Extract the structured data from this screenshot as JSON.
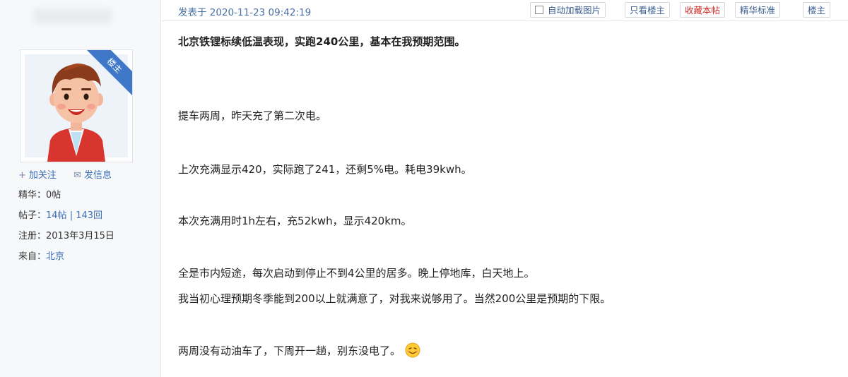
{
  "sidebar": {
    "badge": "楼主",
    "follow_label": "加关注",
    "message_label": "发信息",
    "info": {
      "essence_label": "精华：",
      "essence_value": "0帖",
      "posts_label": "帖子：",
      "posts_topics": "14帖",
      "posts_sep": "|",
      "posts_replies": "143回",
      "registered_label": "注册：",
      "registered_value": "2013年3月15日",
      "from_label": "来自：",
      "from_value": "北京"
    }
  },
  "topbar": {
    "post_time": "发表于 2020-11-23 09:42:19",
    "buttons": {
      "auto_load_images": "自动加载图片",
      "only_op": "只看楼主",
      "favorite": "收藏本帖",
      "essence_rules": "精华标准",
      "floor": "楼主"
    }
  },
  "post": {
    "title": "北京铁锂标续低温表现，实跑240公里，基本在我预期范围。",
    "paragraphs": [
      "提车两周，昨天充了第二次电。",
      "上次充满显示420，实际跑了241，还剩5%电。耗电39kwh。",
      "本次充满用时1h左右，充52kwh，显示420km。",
      "全是市内短途，每次启动到停止不到4公里的居多。晚上停地库，白天地上。",
      "我当初心理预期冬季能到200以上就满意了，对我来说够用了。当然200公里是预期的下限。",
      "两周没有动油车了，下周开一趟，别东没电了。"
    ],
    "emoji_icon": "smiley-emoji-icon"
  }
}
